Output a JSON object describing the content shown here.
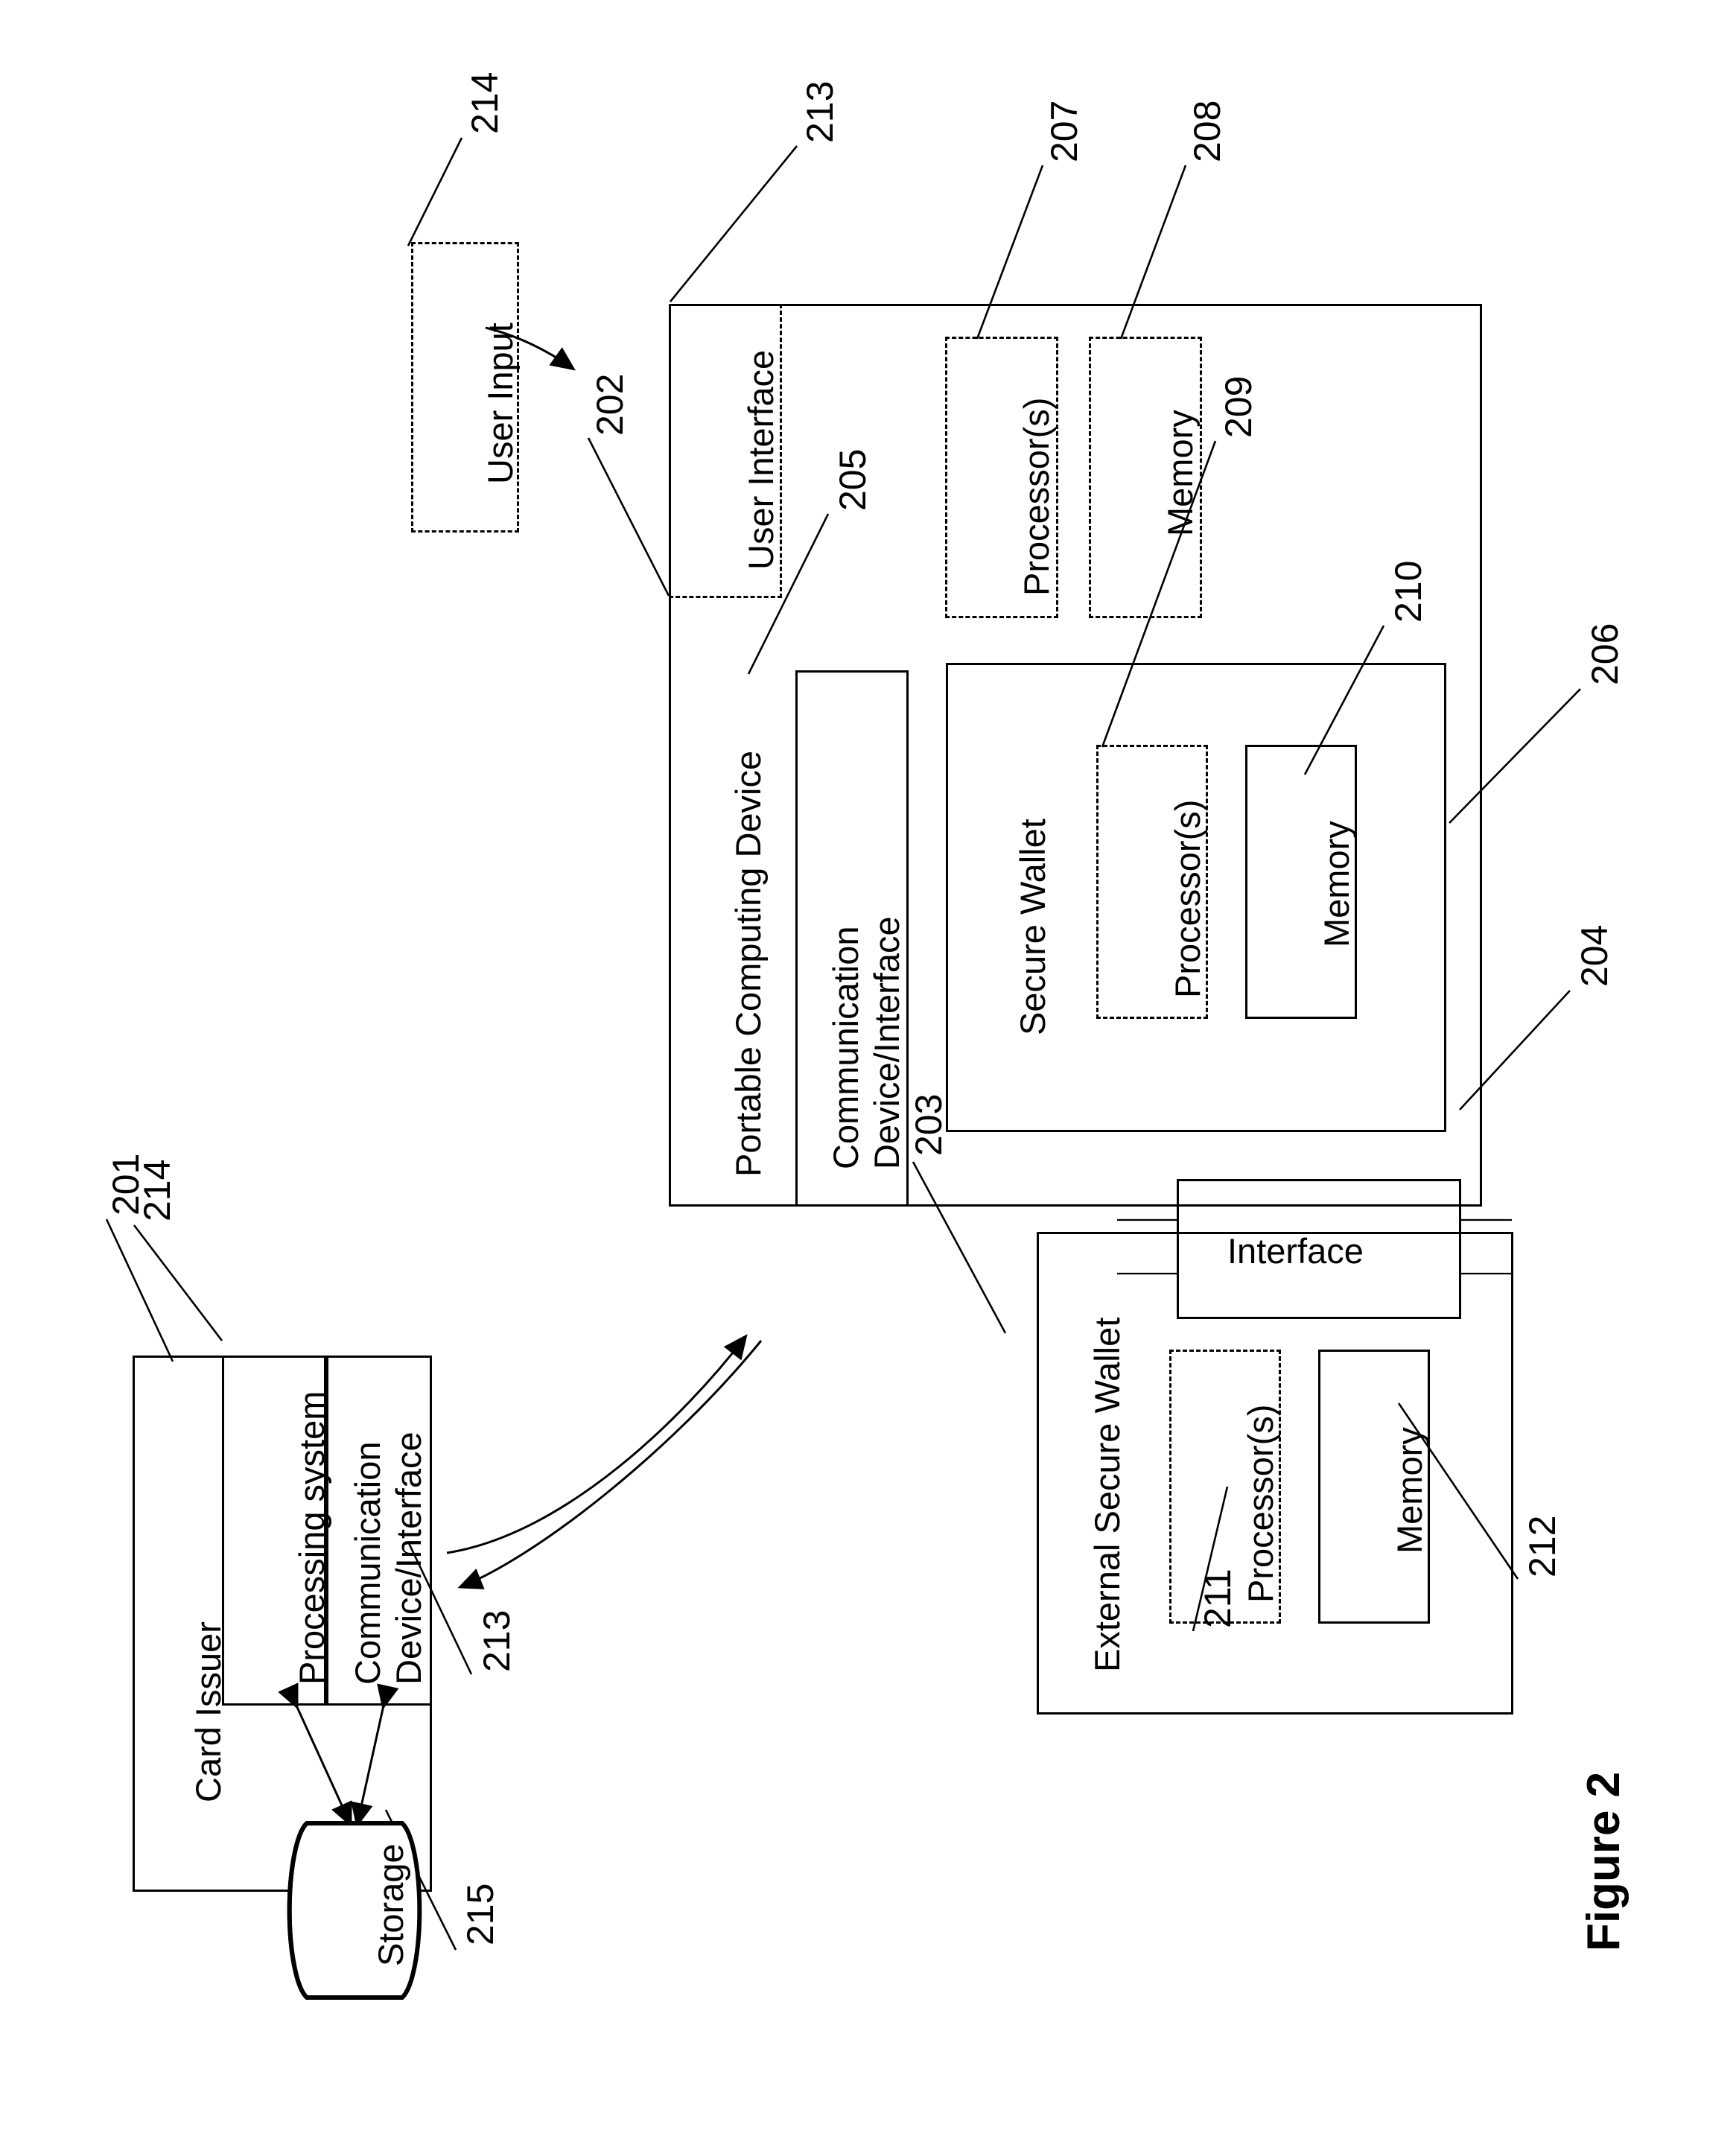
{
  "figure": {
    "caption": "Figure 2"
  },
  "blocks": {
    "user_input": {
      "label": "User Input",
      "ref": "214"
    },
    "user_interface": {
      "label": "User Interface",
      "ref": "213"
    },
    "portable_computing_device": {
      "label": "Portable Computing Device",
      "ref": "202"
    },
    "pcd_processors": {
      "label": "Processor(s)",
      "ref": "207"
    },
    "pcd_memory": {
      "label": "Memory",
      "ref": "208"
    },
    "secure_wallet": {
      "label": "Secure Wallet",
      "ref": "206"
    },
    "sw_processors": {
      "label": "Processor(s)",
      "ref": "209"
    },
    "sw_memory": {
      "label": "Memory",
      "ref": "210"
    },
    "communication_device_interface_pcd": {
      "label_line1": "Communication",
      "label_line2": "Device/Interface",
      "ref": "205"
    },
    "interface": {
      "label": "Interface",
      "ref": "204"
    },
    "external_secure_wallet": {
      "label": "External Secure Wallet",
      "ref": "203"
    },
    "esw_processors": {
      "label": "Processor(s)",
      "ref": "211"
    },
    "esw_memory": {
      "label": "Memory",
      "ref": "212"
    },
    "card_issuer": {
      "label": "Card Issuer",
      "ref": "201"
    },
    "processing_system": {
      "label": "Processing system",
      "ref": "214"
    },
    "communication_device_interface_issuer": {
      "label_line1": "Communication",
      "label_line2": "Device/Interface",
      "ref": "213"
    },
    "storage": {
      "label": "Storage",
      "ref": "215"
    }
  },
  "refs": {
    "r201": "201",
    "r202": "202",
    "r203": "203",
    "r204": "204",
    "r205": "205",
    "r206": "206",
    "r207": "207",
    "r208": "208",
    "r209": "209",
    "r210": "210",
    "r211": "211",
    "r212": "212",
    "r213_ui": "213",
    "r213_issuer": "213",
    "r214_input": "214",
    "r214_procsys": "214",
    "r215": "215"
  },
  "colors": {
    "stroke": "#000000",
    "background": "#ffffff"
  }
}
